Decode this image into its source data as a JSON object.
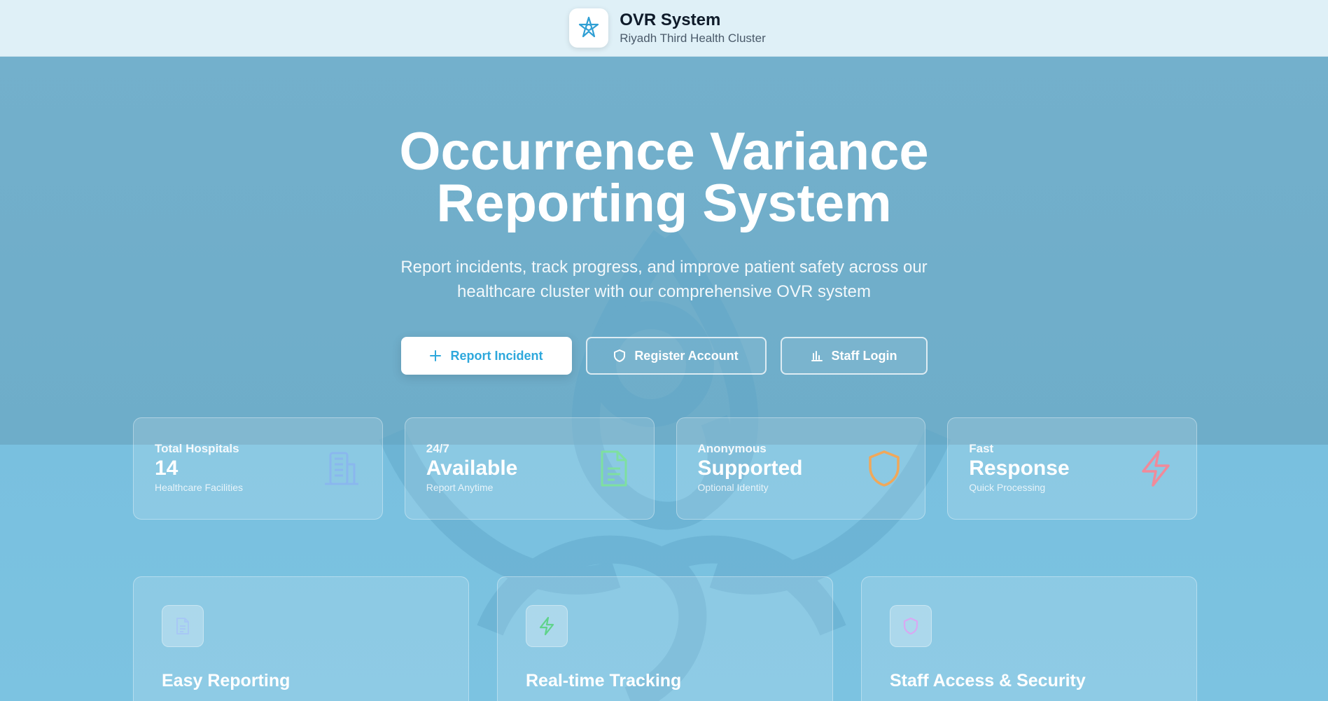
{
  "header": {
    "title": "OVR System",
    "subtitle": "Riyadh Third Health Cluster",
    "logo_icon": "star-flower-icon"
  },
  "hero": {
    "title_line1": "Occurrence Variance",
    "title_line2": "Reporting System",
    "description": "Report incidents, track progress, and improve patient safety across our healthcare cluster with our comprehensive OVR system"
  },
  "actions": {
    "report": {
      "label": "Report Incident",
      "icon": "plus-icon"
    },
    "register": {
      "label": "Register Account",
      "icon": "shield-icon"
    },
    "login": {
      "label": "Staff Login",
      "icon": "bar-chart-icon"
    }
  },
  "stats": [
    {
      "label": "Total Hospitals",
      "value": "14",
      "desc": "Healthcare Facilities",
      "icon": "building-icon",
      "color": "#8ab4f0"
    },
    {
      "label": "24/7",
      "value": "Available",
      "desc": "Report Anytime",
      "icon": "document-icon",
      "color": "#7ee0a0"
    },
    {
      "label": "Anonymous",
      "value": "Supported",
      "desc": "Optional Identity",
      "icon": "shield-icon",
      "color": "#f0a85a"
    },
    {
      "label": "Fast",
      "value": "Response",
      "desc": "Quick Processing",
      "icon": "lightning-icon",
      "color": "#f08a9a"
    }
  ],
  "features": [
    {
      "title": "Easy Reporting",
      "icon": "document-icon",
      "color": "#a7c8f5"
    },
    {
      "title": "Real-time Tracking",
      "icon": "lightning-icon",
      "color": "#5fd38a"
    },
    {
      "title": "Staff Access & Security",
      "icon": "shield-icon",
      "color": "#d9a8f2"
    }
  ],
  "colors": {
    "primary": "#2ea8dc",
    "header_bg": "#dff0f7",
    "page_bg": "#7bbfdd"
  }
}
